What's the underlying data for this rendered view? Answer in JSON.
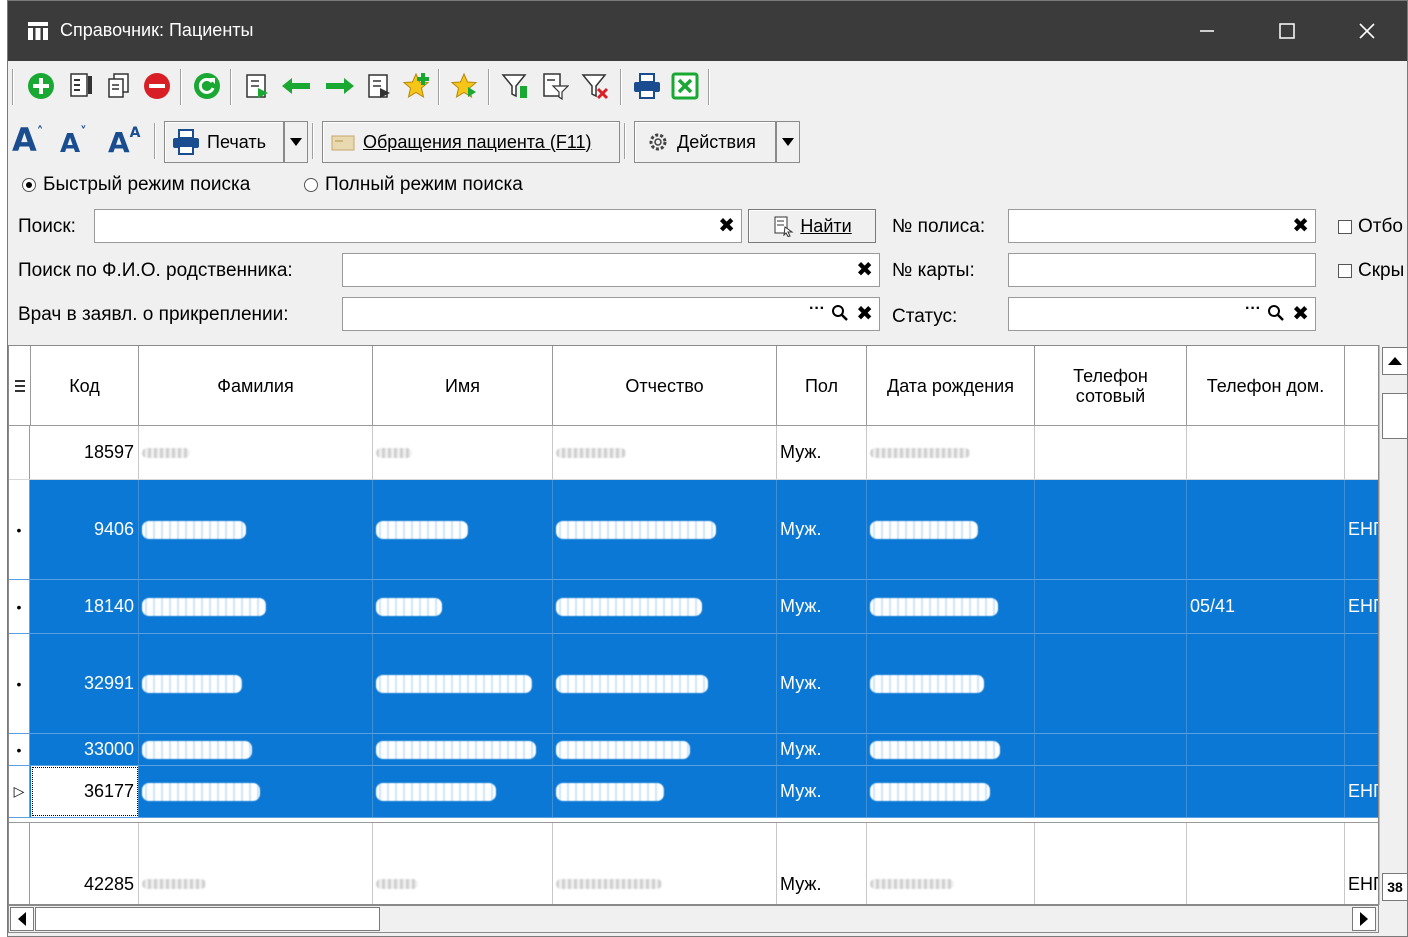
{
  "window": {
    "title": "Справочник: Пациенты",
    "minimize": "—",
    "maximize": "☐",
    "close": "✕"
  },
  "toolbar": {
    "icons": [
      "add-icon",
      "edit-icon",
      "copy-icon",
      "delete-icon",
      "refresh-icon",
      "select-icon",
      "arrow-left-icon",
      "arrow-right-icon",
      "select-record-icon",
      "favorites-add-icon",
      "favorites-icon",
      "filter-icon",
      "filter-edit-icon",
      "filter-clear-icon",
      "print-icon",
      "excel-export-icon"
    ],
    "font_increase": "A",
    "font_decrease": "A",
    "font_default": "A",
    "print_label": "Печать",
    "appeals_label": "Обращения пациента (F11)",
    "actions_label": "Действия"
  },
  "search_mode": {
    "fast_label": "Быстрый режим поиска",
    "full_label": "Полный режим поиска",
    "selected": "fast"
  },
  "filters": {
    "search_label": "Поиск:",
    "search_value": "",
    "find_label": "Найти",
    "relative_label": "Поиск по Ф.И.О. родственника:",
    "relative_value": "",
    "doctor_label": "Врач в заявл. о прикреплении:",
    "doctor_value": "",
    "policy_label": "№ полиса:",
    "policy_value": "",
    "card_label": "№ карты:",
    "card_value": "",
    "status_label": "Статус:",
    "status_value": "",
    "check1_label": "Отбо",
    "check2_label": "Скры",
    "clear_symbol": "✖",
    "dots_symbol": "···"
  },
  "grid": {
    "columns": [
      "Код",
      "Фамилия",
      "Имя",
      "Отчество",
      "Пол",
      "Дата рождения",
      "Телефон сотовый",
      "Телефон дом.",
      ""
    ],
    "rows": [
      {
        "code": "18597",
        "gender": "Муж.",
        "phone_home": "",
        "extra": "",
        "selected": false,
        "marker": ""
      },
      {
        "code": "9406",
        "gender": "Муж.",
        "phone_home": "",
        "extra": "ЕНП",
        "selected": true,
        "marker": "•"
      },
      {
        "code": "18140",
        "gender": "Муж.",
        "phone_home": "05/41",
        "extra": "ЕНП",
        "selected": true,
        "marker": "•"
      },
      {
        "code": "32991",
        "gender": "Муж.",
        "phone_home": "",
        "extra": "",
        "selected": true,
        "marker": "•"
      },
      {
        "code": "33000",
        "gender": "Муж.",
        "phone_home": "",
        "extra": "",
        "selected": true,
        "marker": "•"
      },
      {
        "code": "36177",
        "gender": "Муж.",
        "phone_home": "",
        "extra": "ЕНП",
        "selected": true,
        "marker": "▷"
      },
      {
        "code": "42285",
        "gender": "Муж.",
        "phone_home": "",
        "extra": "ЕНП",
        "selected": false,
        "marker": ""
      }
    ],
    "scroll_badge": "38"
  },
  "colors": {
    "titlebar": "#3b3b3b",
    "selection": "#0a78d4",
    "accent_green": "#19a832",
    "accent_red": "#d81f26"
  }
}
